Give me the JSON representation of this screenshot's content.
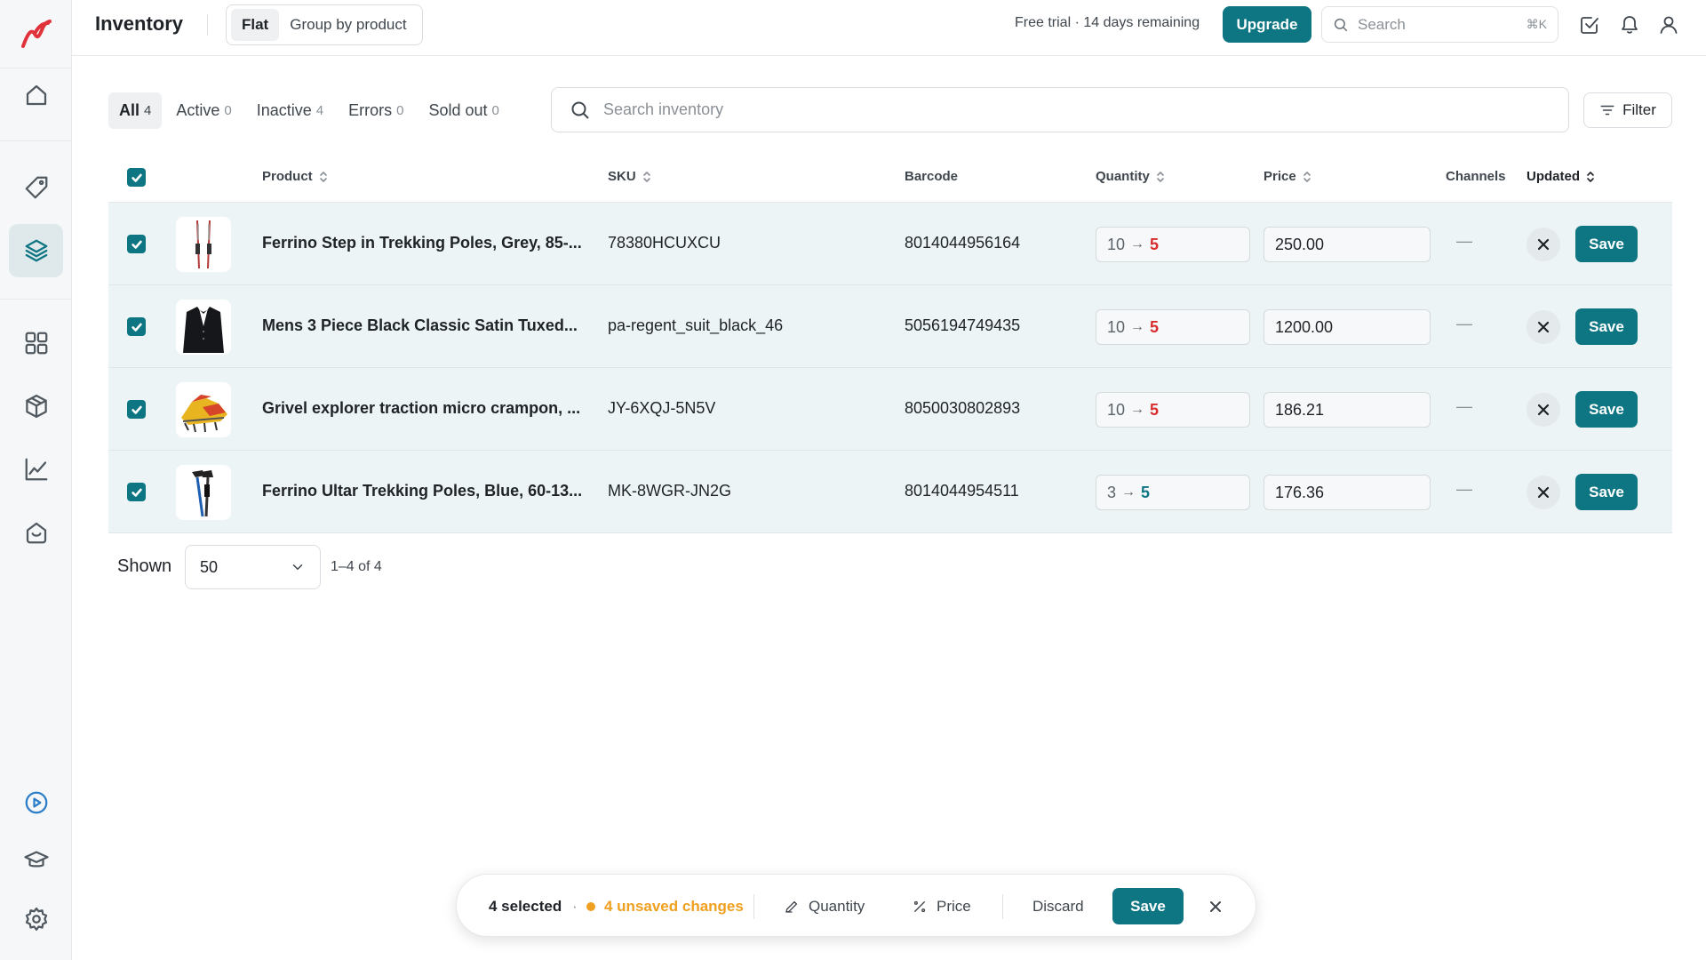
{
  "app": {
    "logo_icon": "app-logo-icon"
  },
  "sidebar": {
    "items": [
      {
        "name": "home",
        "icon": "home-icon"
      },
      {
        "name": "tags",
        "icon": "tag-icon"
      },
      {
        "name": "inventory",
        "icon": "layers-icon",
        "active": true
      },
      {
        "name": "apps",
        "icon": "grid-icon"
      },
      {
        "name": "products",
        "icon": "box-icon"
      },
      {
        "name": "analytics",
        "icon": "chart-line-icon"
      },
      {
        "name": "store",
        "icon": "store-icon"
      },
      {
        "name": "play",
        "icon": "play-icon"
      },
      {
        "name": "learn",
        "icon": "graduation-cap-icon"
      },
      {
        "name": "settings",
        "icon": "gear-icon"
      }
    ]
  },
  "header": {
    "title": "Inventory",
    "view_options": [
      "Flat",
      "Group by product"
    ],
    "active_view": "Flat",
    "trial_text": "Free trial · 14 days remaining",
    "upgrade_label": "Upgrade",
    "search_placeholder": "Search",
    "search_shortcut": "⌘K"
  },
  "filters": {
    "tabs": [
      {
        "label": "All",
        "count": "4",
        "active": true
      },
      {
        "label": "Active",
        "count": "0"
      },
      {
        "label": "Inactive",
        "count": "4"
      },
      {
        "label": "Errors",
        "count": "0"
      },
      {
        "label": "Sold out",
        "count": "0"
      }
    ],
    "search_placeholder": "Search inventory",
    "filter_label": "Filter"
  },
  "table": {
    "columns": {
      "product": "Product",
      "sku": "SKU",
      "barcode": "Barcode",
      "quantity": "Quantity",
      "price": "Price",
      "channels": "Channels",
      "updated": "Updated"
    },
    "rows": [
      {
        "product": "Ferrino Step in Trekking Poles, Grey, 85-...",
        "sku": "78380HCUXCU",
        "barcode": "8014044956164",
        "qty_old": "10",
        "qty_new": "5",
        "qty_dir": "down",
        "price": "250.00",
        "channels": "—",
        "save_label": "Save",
        "thumb": "poles-grey"
      },
      {
        "product": "Mens 3 Piece Black Classic Satin Tuxed...",
        "sku": "pa-regent_suit_black_46",
        "barcode": "5056194749435",
        "qty_old": "10",
        "qty_new": "5",
        "qty_dir": "down",
        "price": "1200.00",
        "channels": "—",
        "save_label": "Save",
        "thumb": "tuxedo"
      },
      {
        "product": "Grivel explorer traction micro crampon, ...",
        "sku": "JY-6XQJ-5N5V",
        "barcode": "8050030802893",
        "qty_old": "10",
        "qty_new": "5",
        "qty_dir": "down",
        "price": "186.21",
        "channels": "—",
        "save_label": "Save",
        "thumb": "crampon"
      },
      {
        "product": "Ferrino Ultar Trekking Poles, Blue, 60-13...",
        "sku": "MK-8WGR-JN2G",
        "barcode": "8014044954511",
        "qty_old": "3",
        "qty_new": "5",
        "qty_dir": "up",
        "price": "176.36",
        "channels": "—",
        "save_label": "Save",
        "thumb": "poles-blue"
      }
    ]
  },
  "pagination": {
    "shown_label": "Shown",
    "page_size": "50",
    "range_text": "1–4 of 4"
  },
  "bulk_bar": {
    "selected_text": "4 selected",
    "separator": "·",
    "unsaved_text": "4 unsaved changes",
    "quantity_label": "Quantity",
    "price_label": "Price",
    "discard_label": "Discard",
    "save_label": "Save"
  },
  "colors": {
    "accent": "#0e7583",
    "warning": "#f0a020",
    "decrease": "#d92d2d"
  }
}
